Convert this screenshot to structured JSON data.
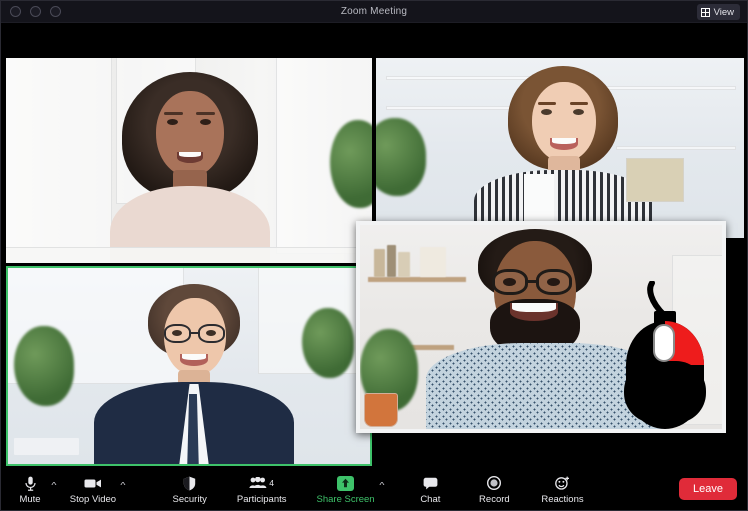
{
  "window": {
    "title": "Zoom Meeting",
    "traffic_lights": [
      "close",
      "minimize",
      "maximize"
    ]
  },
  "header": {
    "view_button": {
      "label": "View",
      "icon": "grid-icon"
    }
  },
  "meeting": {
    "participant_count": "4",
    "tiles": [
      {
        "id": "top-left",
        "speaker": false,
        "name": ""
      },
      {
        "id": "top-right",
        "speaker": false,
        "name": ""
      },
      {
        "id": "bottom-left",
        "speaker": true,
        "name": ""
      },
      {
        "id": "floating",
        "speaker": false,
        "name": ""
      }
    ],
    "active_speaker_color": "#3ec26a",
    "overlay_graphic": "computer-mouse-icon"
  },
  "toolbar": {
    "mute": {
      "label": "Mute",
      "icon": "microphone-icon",
      "has_caret": true
    },
    "video": {
      "label": "Stop Video",
      "icon": "camera-icon",
      "has_caret": true
    },
    "security": {
      "label": "Security",
      "icon": "shield-icon"
    },
    "participants": {
      "label": "Participants",
      "icon": "people-icon",
      "count": "4"
    },
    "share_screen": {
      "label": "Share Screen",
      "icon": "share-up-arrow-icon",
      "has_caret": true,
      "color": "#3ec26a"
    },
    "chat": {
      "label": "Chat",
      "icon": "chat-bubble-icon"
    },
    "record": {
      "label": "Record",
      "icon": "record-circle-icon"
    },
    "reactions": {
      "label": "Reactions",
      "icon": "smiley-plus-icon"
    },
    "leave": {
      "label": "Leave",
      "color": "#e02b39"
    }
  }
}
